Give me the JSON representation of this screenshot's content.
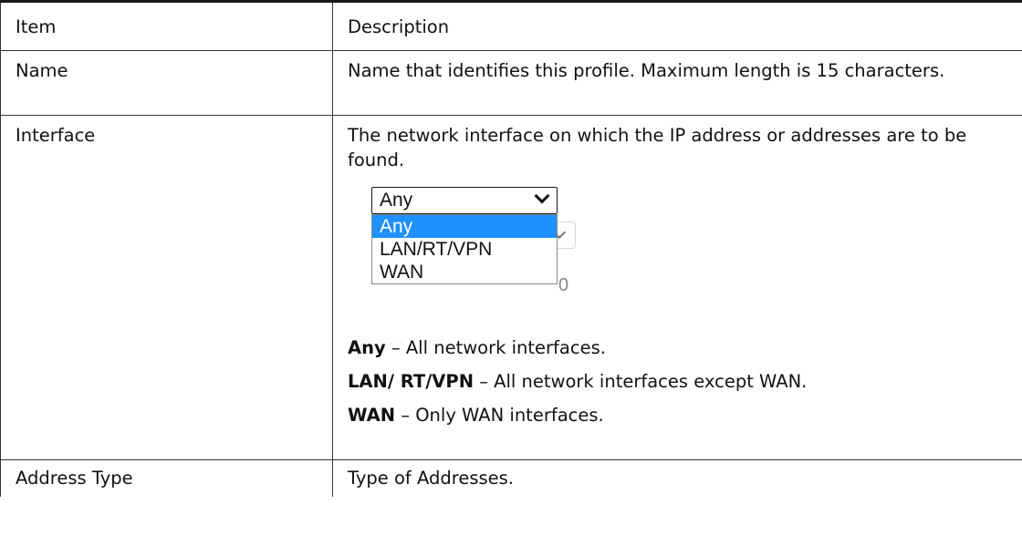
{
  "table": {
    "header": {
      "item": "Item",
      "description": "Description"
    },
    "rows": [
      {
        "item": "Name",
        "description": "Name that identifies this profile. Maximum length is 15 characters."
      },
      {
        "item": "Interface",
        "description": "The network interface on which the IP address or addresses are to be found.",
        "select": {
          "value": "Any",
          "options": [
            "Any",
            "LAN/RT/VPN",
            "WAN"
          ],
          "highlighted": "Any",
          "highlight_color": "#1e90ff"
        },
        "definitions": [
          {
            "term": "Any",
            "text": " – All network interfaces."
          },
          {
            "term": "LAN/ RT/VPN",
            "text": " – All network interfaces except WAN."
          },
          {
            "term": "WAN",
            "text": " – Only WAN interfaces."
          }
        ]
      },
      {
        "item": "Address Type",
        "description": "Type of Addresses."
      }
    ]
  }
}
